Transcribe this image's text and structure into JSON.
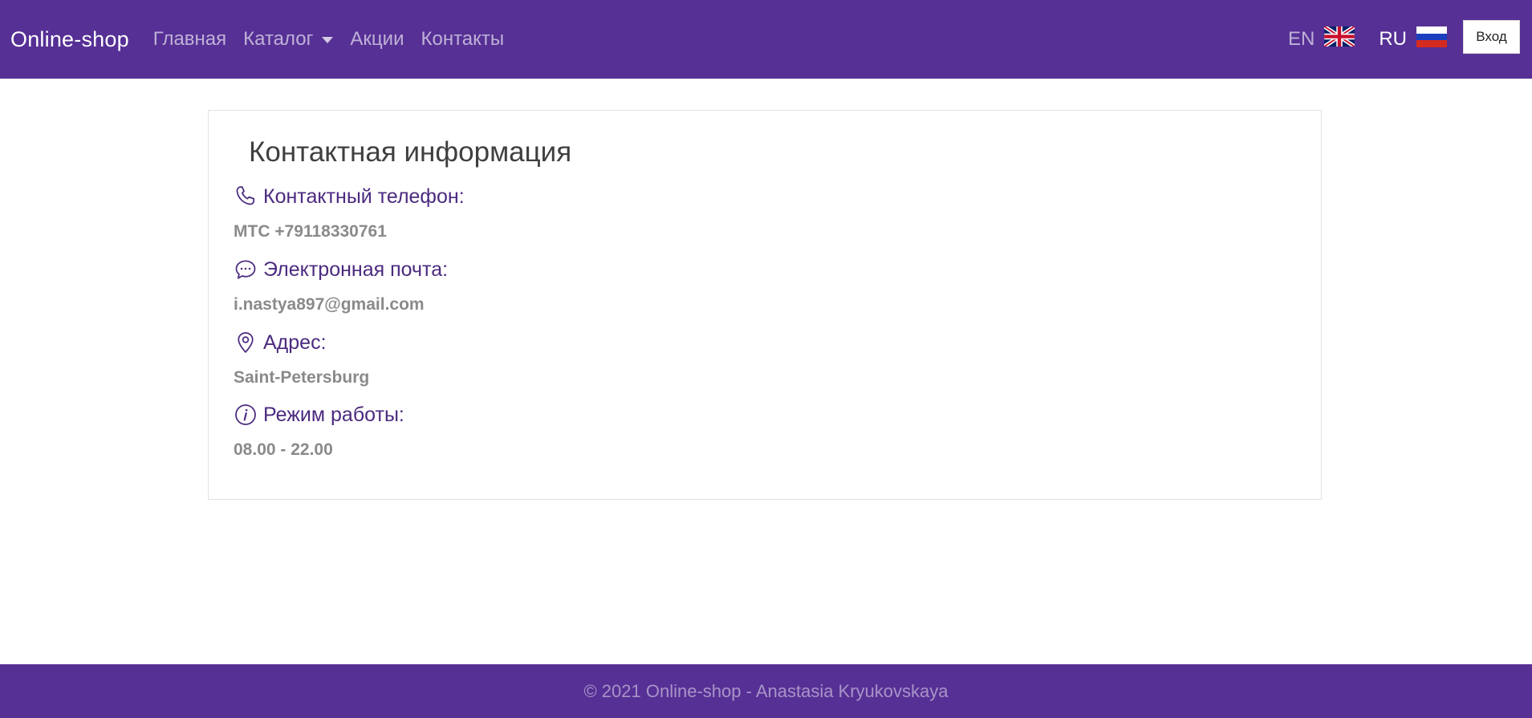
{
  "navbar": {
    "brand": "Online-shop",
    "links": [
      {
        "label": "Главная"
      },
      {
        "label": "Каталог"
      },
      {
        "label": "Акции"
      },
      {
        "label": "Контакты"
      }
    ],
    "languages": [
      {
        "code": "EN",
        "flag_icon": "uk-flag-icon"
      },
      {
        "code": "RU",
        "flag_icon": "russia-flag-icon"
      }
    ],
    "login_label": "Вход",
    "background_color": "#563095"
  },
  "contacts": {
    "title": "Контактная информация",
    "items": [
      {
        "icon": "phone-icon",
        "label": "Контактный телефон:",
        "value": "МТС +79118330761"
      },
      {
        "icon": "chat-bubble-icon",
        "label": "Электронная почта:",
        "value": "i.nastya897@gmail.com"
      },
      {
        "icon": "map-pin-icon",
        "label": "Адрес:",
        "value": "Saint-Petersburg"
      },
      {
        "icon": "info-icon",
        "label": "Режим работы:",
        "value": "08.00 - 22.00"
      }
    ],
    "accent_color": "#4b2a7f"
  },
  "footer": {
    "text": "© 2021 Online-shop - Anastasia Kryukovskaya",
    "background_color": "#563095"
  }
}
